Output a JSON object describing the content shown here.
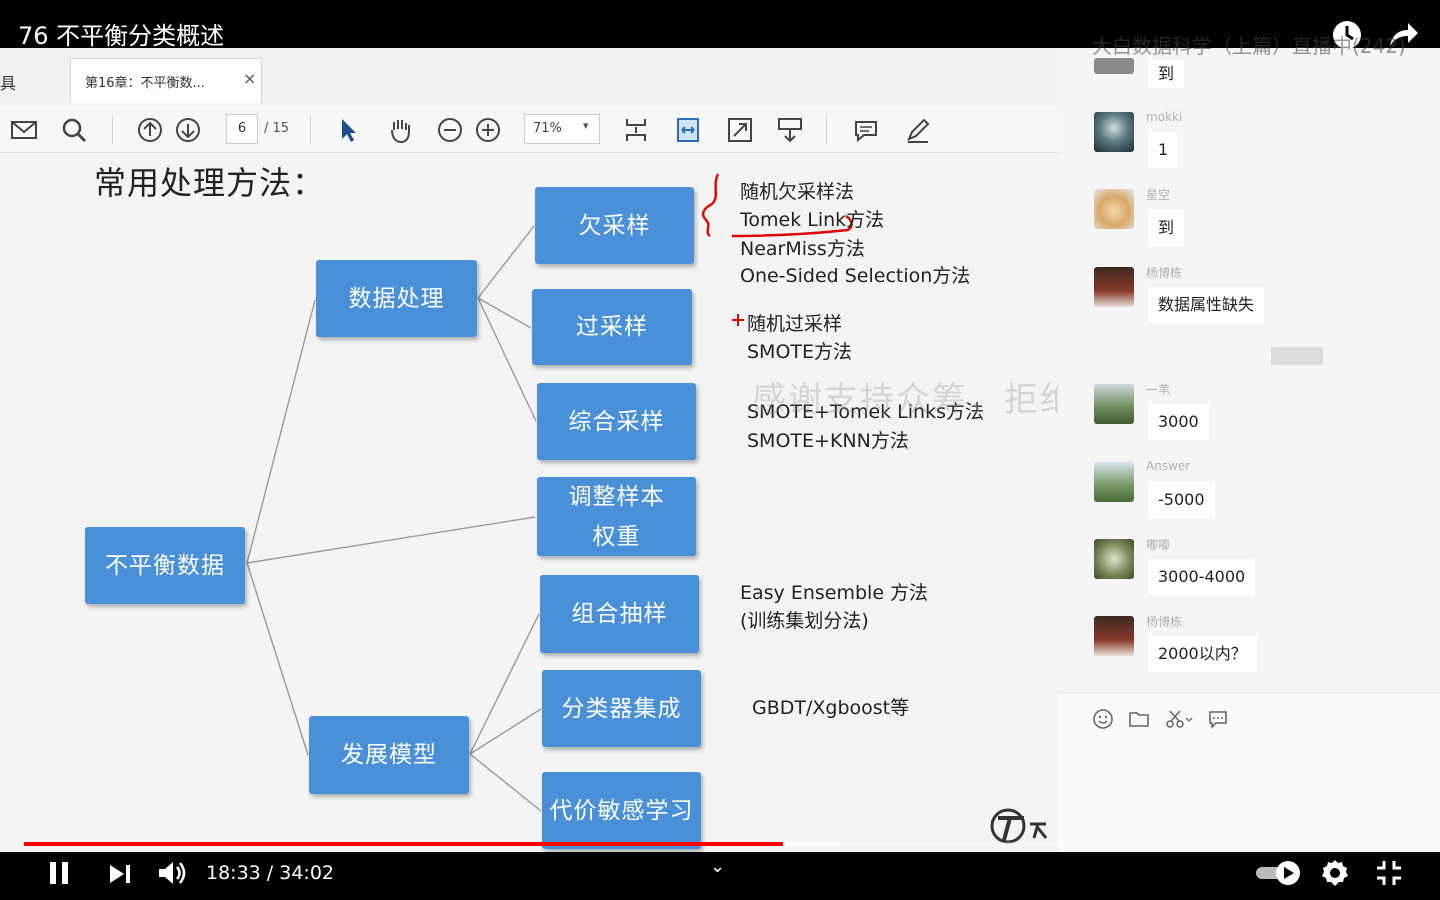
{
  "video": {
    "title": "76 不平衡分类概述",
    "time_display": "18:33 / 34:02",
    "progress": 0.545,
    "buffered": 0.588
  },
  "pdf": {
    "tools_label": "具",
    "tab_label": "第16章：不平衡数...",
    "tab_close": "×",
    "page_current": "6",
    "page_total": "/ 15",
    "zoom": "71%",
    "zoom_caret": "▾"
  },
  "slide": {
    "title": "常用处理方法：",
    "nodes": {
      "root": "不平衡数据",
      "data_processing": "数据处理",
      "develop_model": "发展模型",
      "undersample": "欠采样",
      "oversample": "过采样",
      "combined_sampling": "综合采样",
      "adjust_weight": "调整样本\n权重",
      "combined_extract": "组合抽样",
      "classifier_ensemble": "分类器集成",
      "cost_sensitive": "代价敏感学习"
    },
    "notes": {
      "under_1": "随机欠采样法",
      "under_2": "Tomek Link方法",
      "under_3": "NearMiss方法",
      "under_4": "One-Sided Selection方法",
      "over_1": "随机过采样",
      "over_2": "SMOTE方法",
      "combo_1": "SMOTE+Tomek Links方法",
      "combo_2": "SMOTE+KNN方法",
      "extract_1": "Easy Ensemble 方法",
      "extract_2": "(训练集划分法)",
      "ensemble_1": "GBDT/Xgboost等"
    },
    "watermark": "感谢支持众筹，拒绝违法倒卖更新联系微信"
  },
  "chat": {
    "header": "大白数据科学（上篇）直播中(242)",
    "messages": [
      {
        "name": "mokki",
        "text": "1"
      },
      {
        "name": "星空",
        "text": "到"
      },
      {
        "name": "杨博栋",
        "text": "数据属性缺失"
      },
      {
        "name": "一苇",
        "text": "3000"
      },
      {
        "name": "Answer",
        "text": "-5000"
      },
      {
        "name": "嘟嘟",
        "text": "3000-4000"
      },
      {
        "name": "杨博栋",
        "text": "2000以内？"
      }
    ],
    "prev_text": "到"
  },
  "colors": {
    "node_blue": "#4a90d9",
    "progress_red": "#ff0000",
    "annotation_red": "#e00000"
  }
}
